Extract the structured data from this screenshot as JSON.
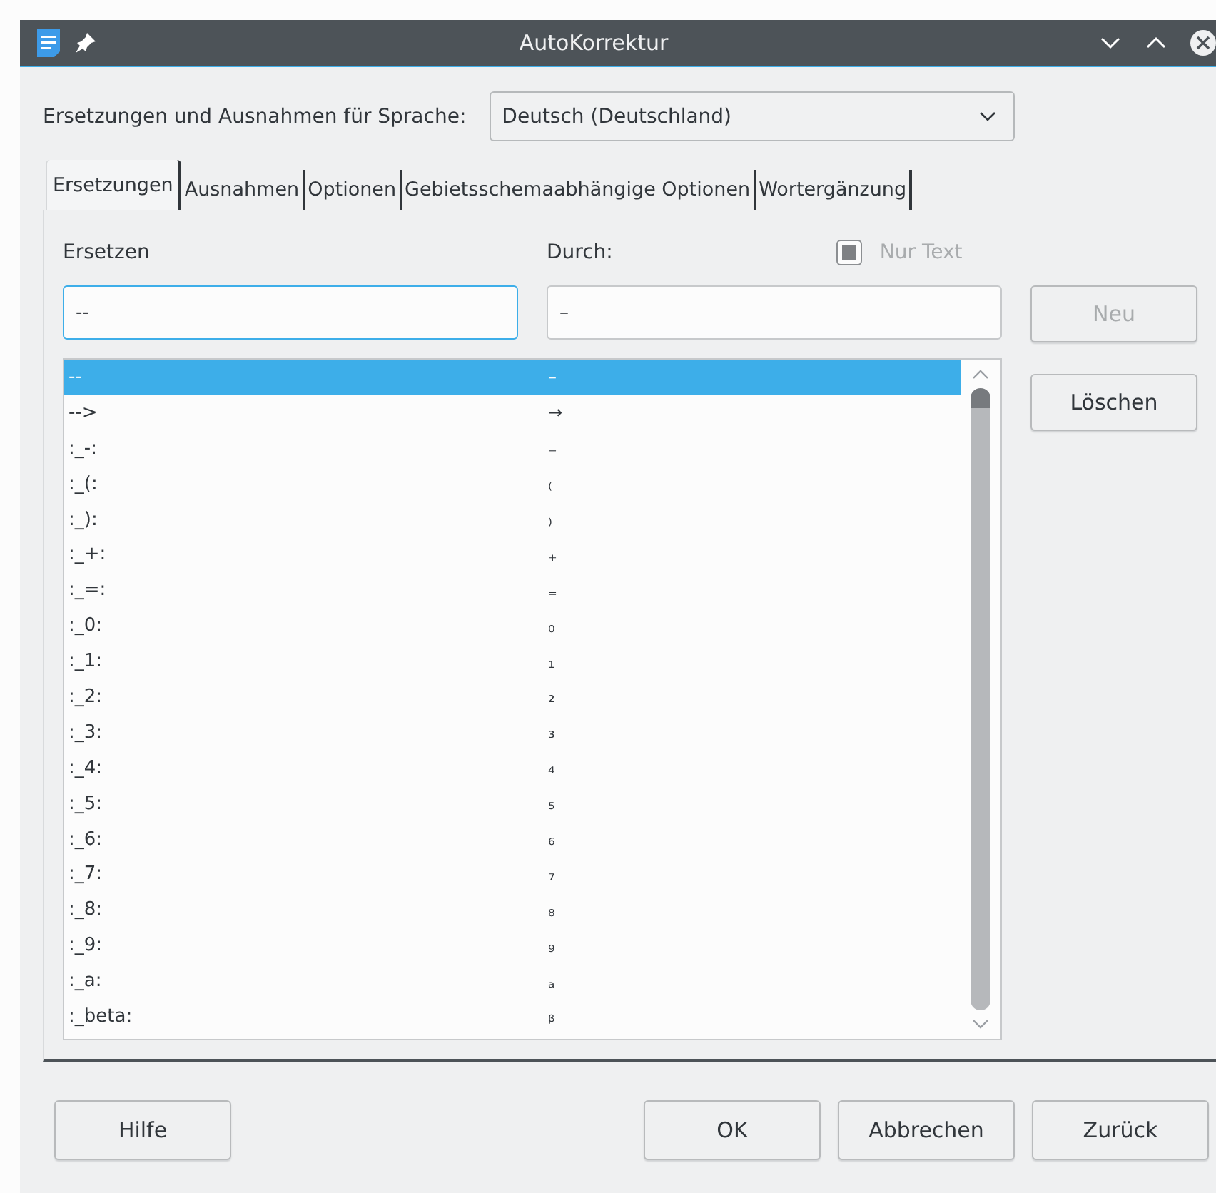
{
  "window": {
    "title": "AutoKorrektur"
  },
  "language": {
    "label": "Ersetzungen und Ausnahmen für Sprache:",
    "value": "Deutsch (Deutschland)"
  },
  "tabs": [
    {
      "label": "Ersetzungen",
      "selected": true
    },
    {
      "label": "Ausnahmen",
      "selected": false
    },
    {
      "label": "Optionen",
      "selected": false
    },
    {
      "label": "Gebietsschemaabhängige Optionen",
      "selected": false
    },
    {
      "label": "Wortergänzung",
      "selected": false
    }
  ],
  "replace": {
    "label": "Ersetzen",
    "value": "--"
  },
  "with": {
    "label": "Durch:",
    "value": "–"
  },
  "text_only": {
    "label": "Nur Text",
    "checked": true,
    "disabled": true
  },
  "side_buttons": [
    {
      "label": "Neu",
      "disabled": true
    },
    {
      "label": "Löschen",
      "disabled": false
    }
  ],
  "table": {
    "rows": [
      {
        "replace": "--",
        "with": "–",
        "selected": true
      },
      {
        "replace": "-->",
        "with": "→",
        "selected": false
      },
      {
        "replace": ":_-:",
        "with": "₋",
        "selected": false
      },
      {
        "replace": ":_(:",
        "with": "₍",
        "selected": false
      },
      {
        "replace": ":_):",
        "with": "₎",
        "selected": false
      },
      {
        "replace": ":_+:",
        "with": "₊",
        "selected": false
      },
      {
        "replace": ":_=:",
        "with": "₌",
        "selected": false
      },
      {
        "replace": ":_0:",
        "with": "₀",
        "selected": false
      },
      {
        "replace": ":_1:",
        "with": "₁",
        "selected": false
      },
      {
        "replace": ":_2:",
        "with": "₂",
        "selected": false
      },
      {
        "replace": ":_3:",
        "with": "₃",
        "selected": false
      },
      {
        "replace": ":_4:",
        "with": "₄",
        "selected": false
      },
      {
        "replace": ":_5:",
        "with": "₅",
        "selected": false
      },
      {
        "replace": ":_6:",
        "with": "₆",
        "selected": false
      },
      {
        "replace": ":_7:",
        "with": "₇",
        "selected": false
      },
      {
        "replace": ":_8:",
        "with": "₈",
        "selected": false
      },
      {
        "replace": ":_9:",
        "with": "₉",
        "selected": false
      },
      {
        "replace": ":_a:",
        "with": "ₐ",
        "selected": false
      },
      {
        "replace": ":_beta:",
        "with": "ᵦ",
        "selected": false
      }
    ]
  },
  "footer_buttons": [
    "Hilfe",
    "OK",
    "Abbrechen",
    "Zurück"
  ]
}
